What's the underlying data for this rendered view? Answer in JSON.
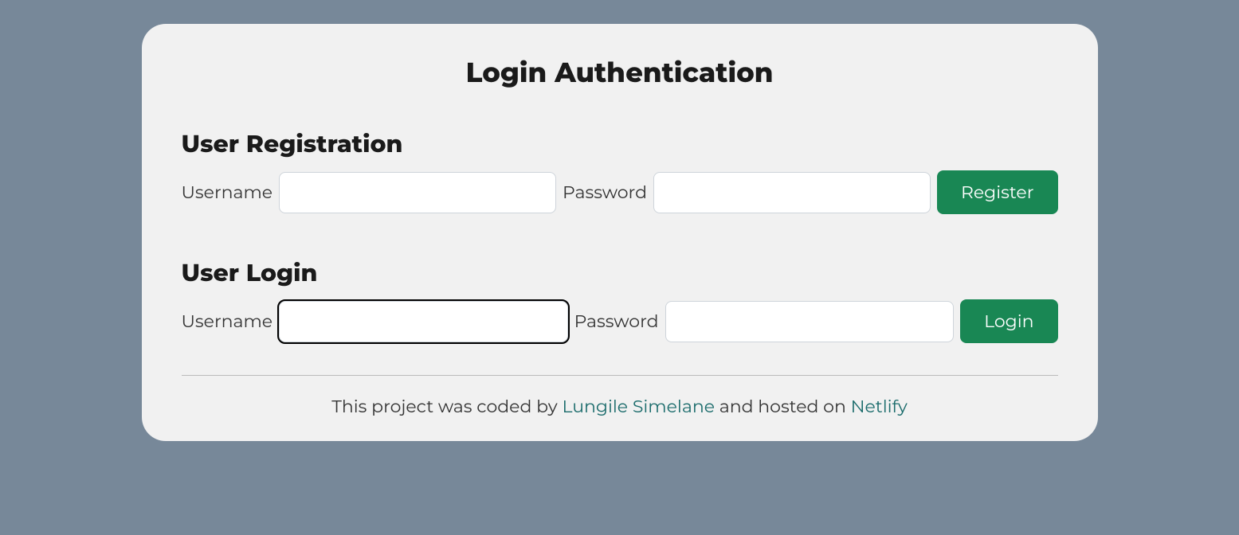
{
  "header": {
    "title": "Login Authentication"
  },
  "registration": {
    "heading": "User Registration",
    "username_label": "Username",
    "username_value": "",
    "password_label": "Password",
    "password_value": "",
    "button_label": "Register"
  },
  "login": {
    "heading": "User Login",
    "username_label": "Username",
    "username_value": "",
    "password_label": "Password",
    "password_value": "",
    "button_label": "Login"
  },
  "footer": {
    "prefix": "This project was coded by ",
    "author": "Lungile Simelane",
    "middle": " and hosted on ",
    "host": "Netlify"
  },
  "colors": {
    "background": "#778899",
    "card": "#f1f1f1",
    "button": "#198754",
    "link": "#1a6b6b"
  }
}
